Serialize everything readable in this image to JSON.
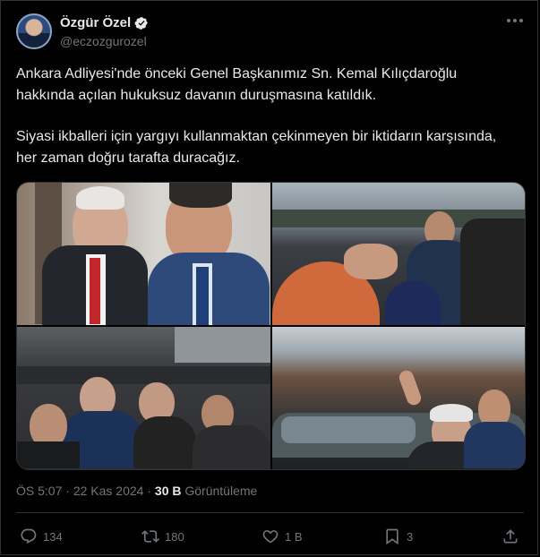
{
  "author": {
    "name": "Özgür Özel",
    "handle": "@eczozgurozel"
  },
  "post": {
    "paragraph1": "Ankara Adliyesi'nde önceki Genel Başkanımız Sn. Kemal Kılıçdaroğlu hakkında açılan hukuksuz davanın duruşmasına katıldık.",
    "paragraph2": "Siyasi ikballeri için yargıyı kullanmaktan çekinmeyen bir iktidarın karşısında, her zaman doğru tarafta duracağız."
  },
  "meta": {
    "time": "ÖS 5:07",
    "separator": " · ",
    "date": "22 Kas 2024",
    "separator2": " · ",
    "views_count": "30 B",
    "views_label": " Görüntüleme"
  },
  "actions": {
    "replies": "134",
    "reposts": "180",
    "likes": "1 B",
    "bookmarks": "3"
  },
  "icons": {
    "verified": "verified-badge-icon",
    "more": "more-icon",
    "reply": "reply-icon",
    "repost": "repost-icon",
    "like": "like-icon",
    "bookmark": "bookmark-icon",
    "share": "share-icon"
  },
  "colors": {
    "background": "#000000",
    "text": "#e7e9ea",
    "muted": "#71767b",
    "border": "#2f3336",
    "verified": "#e7e9ea"
  }
}
